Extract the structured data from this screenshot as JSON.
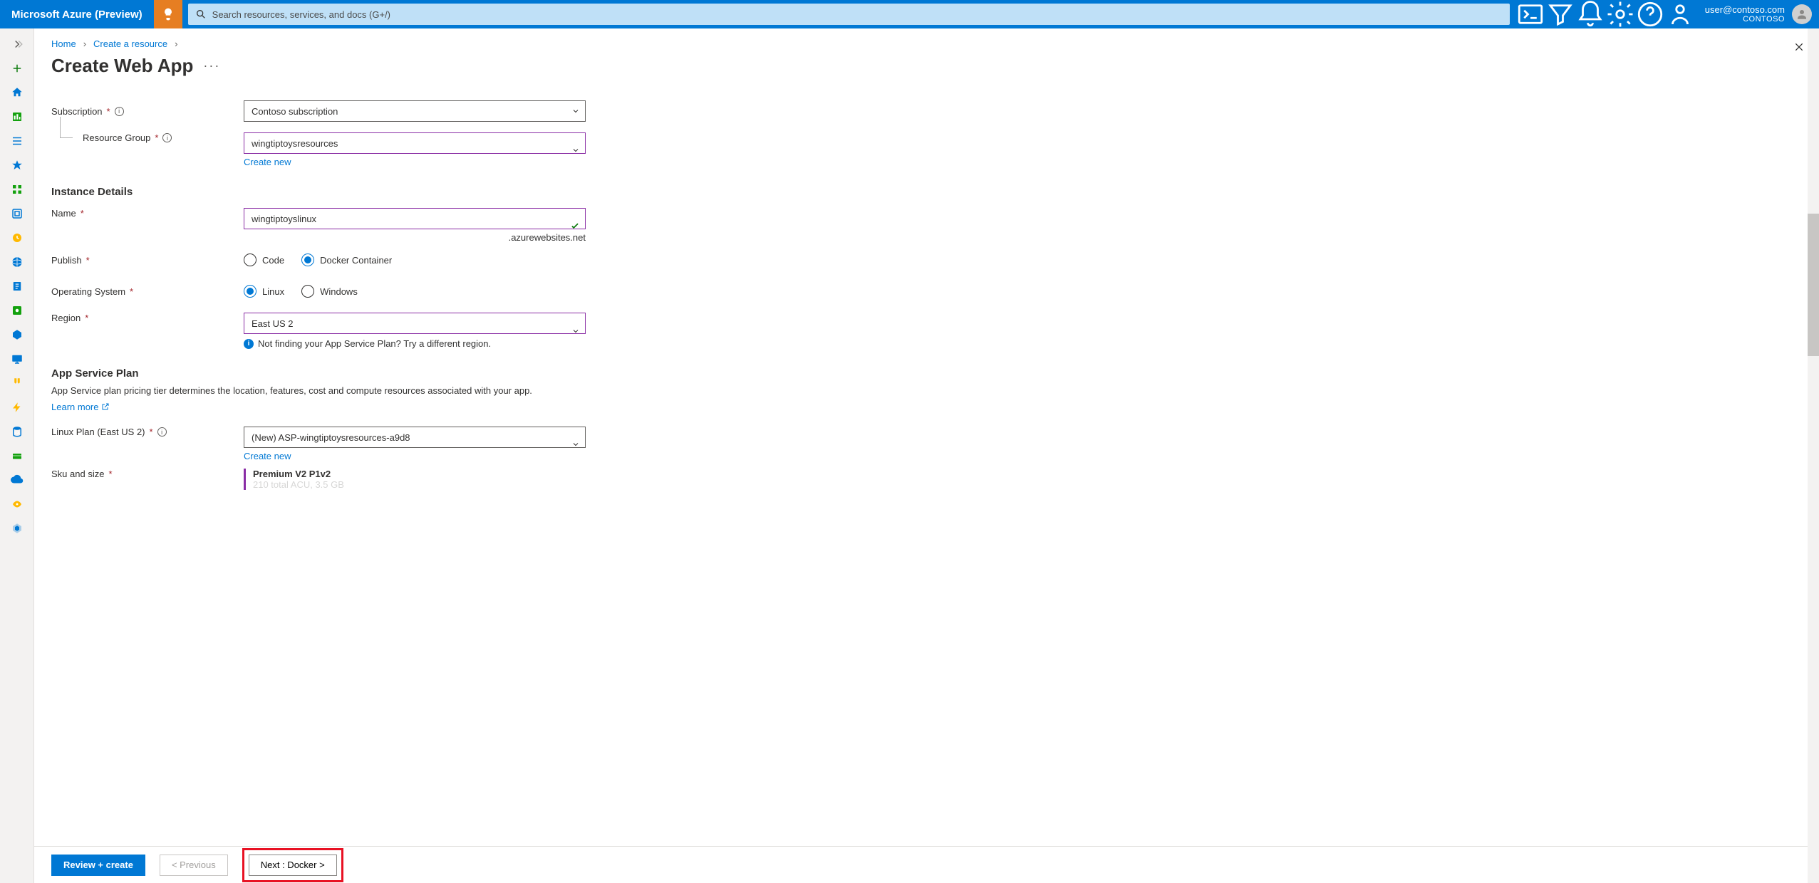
{
  "brand": "Microsoft Azure (Preview)",
  "search": {
    "placeholder": "Search resources, services, and docs (G+/)"
  },
  "account": {
    "email": "user@contoso.com",
    "tenant": "CONTOSO"
  },
  "breadcrumb": {
    "home": "Home",
    "create_resource": "Create a resource"
  },
  "page": {
    "title": "Create Web App"
  },
  "labels": {
    "subscription": "Subscription",
    "resource_group": "Resource Group",
    "instance_details": "Instance Details",
    "name": "Name",
    "publish": "Publish",
    "os": "Operating System",
    "region": "Region",
    "app_service_plan": "App Service Plan",
    "linux_plan": "Linux Plan (East US 2)",
    "sku": "Sku and size"
  },
  "values": {
    "subscription": "Contoso subscription",
    "resource_group": "wingtiptoysresources",
    "name": "wingtiptoyslinux",
    "region": "East US 2",
    "linux_plan": "(New) ASP-wingtiptoysresources-a9d8",
    "sku_name": "Premium V2 P1v2",
    "sku_detail": "210 total ACU, 3.5 GB"
  },
  "links": {
    "create_new": "Create new",
    "learn_more": "Learn more"
  },
  "radios": {
    "publish_code": "Code",
    "publish_docker": "Docker Container",
    "os_linux": "Linux",
    "os_windows": "Windows"
  },
  "text": {
    "suffix": ".azurewebsites.net",
    "region_hint": "Not finding your App Service Plan? Try a different region.",
    "plan_desc": "App Service plan pricing tier determines the location, features, cost and compute resources associated with your app."
  },
  "footer": {
    "review": "Review + create",
    "previous": "< Previous",
    "next": "Next : Docker >"
  }
}
